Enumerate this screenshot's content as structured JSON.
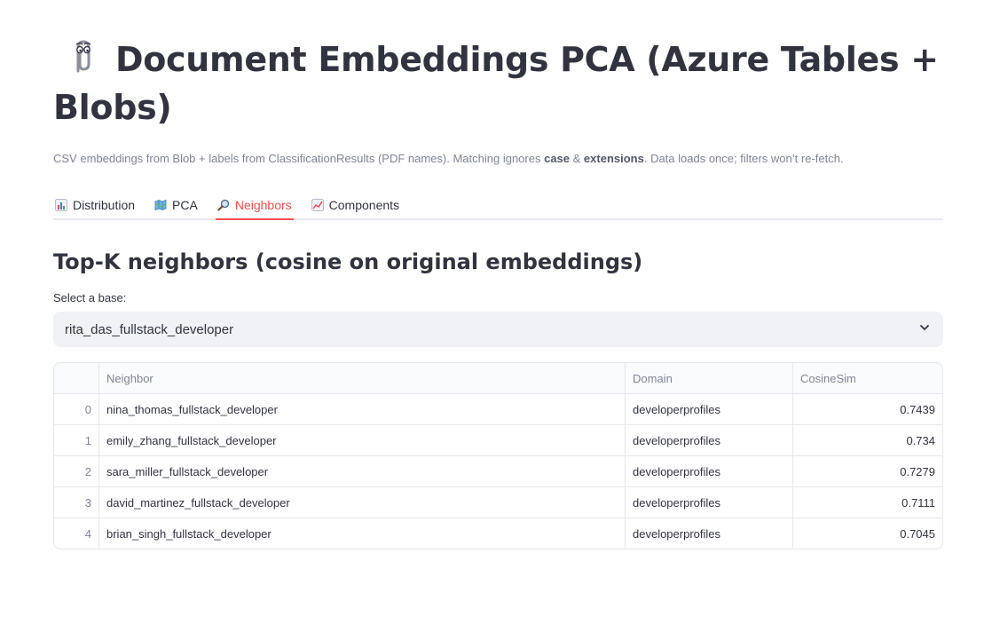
{
  "header": {
    "title": "Document Embeddings PCA (Azure Tables + Blobs)",
    "title_icon": "paperclip-icon",
    "caption_part1": "CSV embeddings from Blob + labels from ClassificationResults (PDF names). Matching ignores ",
    "caption_bold1": "case",
    "caption_part2": " & ",
    "caption_bold2": "extensions",
    "caption_part3": ". Data loads once; filters won’t re-fetch."
  },
  "tabs": [
    {
      "label": "Distribution",
      "icon": "bar-chart-icon",
      "active": false
    },
    {
      "label": "PCA",
      "icon": "map-icon",
      "active": false
    },
    {
      "label": "Neighbors",
      "icon": "magnifier-icon",
      "active": true
    },
    {
      "label": "Components",
      "icon": "line-chart-icon",
      "active": false
    }
  ],
  "section": {
    "heading": "Top-K neighbors (cosine on original embeddings)",
    "select_label": "Select a base:",
    "select_value": "rita_das_fullstack_developer"
  },
  "table": {
    "columns": [
      "",
      "Neighbor",
      "Domain",
      "CosineSim"
    ],
    "rows": [
      {
        "index": "0",
        "neighbor": "nina_thomas_fullstack_developer",
        "domain": "developerprofiles",
        "cosine": "0.7439"
      },
      {
        "index": "1",
        "neighbor": "emily_zhang_fullstack_developer",
        "domain": "developerprofiles",
        "cosine": "0.734"
      },
      {
        "index": "2",
        "neighbor": "sara_miller_fullstack_developer",
        "domain": "developerprofiles",
        "cosine": "0.7279"
      },
      {
        "index": "3",
        "neighbor": "david_martinez_fullstack_developer",
        "domain": "developerprofiles",
        "cosine": "0.7111"
      },
      {
        "index": "4",
        "neighbor": "brian_singh_fullstack_developer",
        "domain": "developerprofiles",
        "cosine": "0.7045"
      }
    ]
  },
  "colors": {
    "accent": "#ff4b4b",
    "text": "#31333f",
    "muted": "#808495",
    "select_bg": "#f0f2f6"
  }
}
